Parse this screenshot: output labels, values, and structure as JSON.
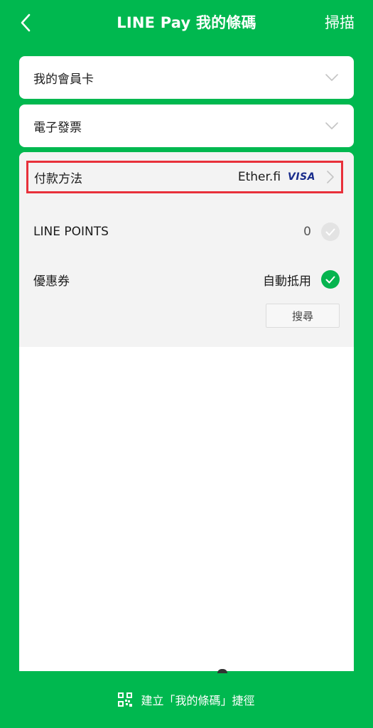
{
  "header": {
    "title": "LINE Pay 我的條碼",
    "scan_label": "掃描",
    "back_icon": "chevron-left-icon"
  },
  "cards": {
    "member_card_label": "我的會員卡",
    "e_invoice_label": "電子發票"
  },
  "payment": {
    "method_label": "付款方法",
    "method_value": "Ether.fi",
    "card_brand": "VISA",
    "highlight_color": "#e8303a"
  },
  "points": {
    "label": "LINE POINTS",
    "value": "0"
  },
  "coupon": {
    "label": "優惠券",
    "status": "自動抵用",
    "search_label": "搜尋"
  },
  "footer": {
    "shortcut_label": "建立「我的條碼」捷徑"
  },
  "colors": {
    "brand_green": "#00b84f",
    "check_green": "#06b44f"
  }
}
